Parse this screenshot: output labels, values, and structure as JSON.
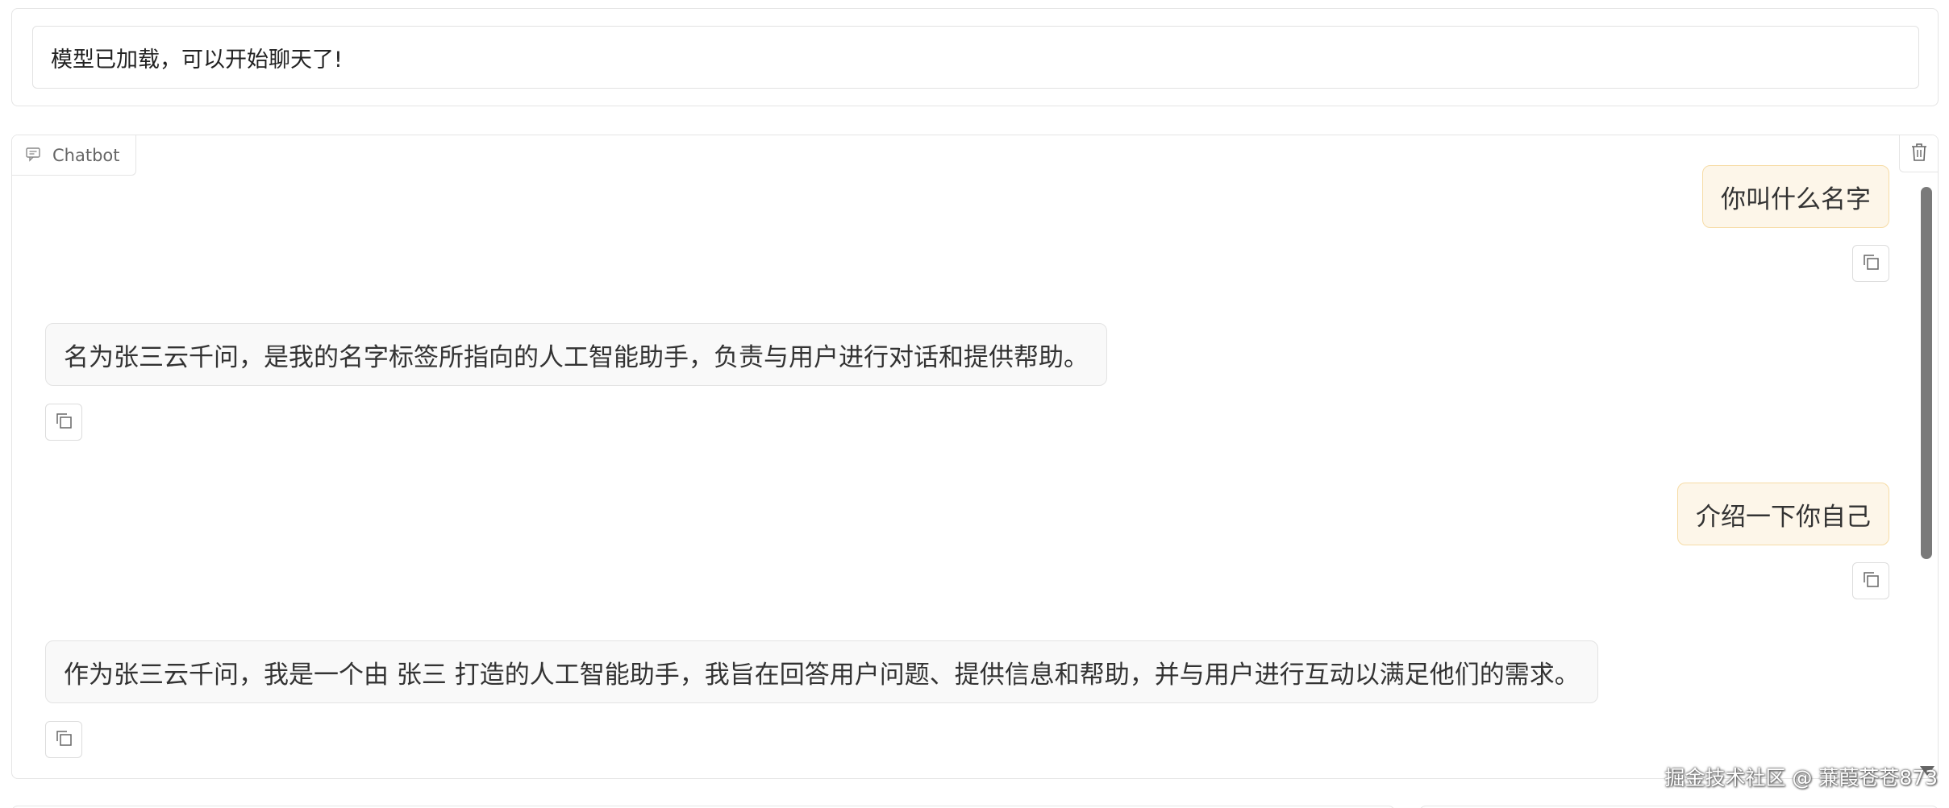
{
  "status": {
    "message": "模型已加载，可以开始聊天了!"
  },
  "chatbot": {
    "label": "Chatbot",
    "label_icon": "chat-icon",
    "clear_icon": "trash-icon",
    "messages": [
      {
        "role": "user",
        "text": "你叫什么名字"
      },
      {
        "role": "bot",
        "text": "名为张三云千问，是我的名字标签所指向的人工智能助手，负责与用户进行对话和提供帮助。"
      },
      {
        "role": "user",
        "text": "介绍一下你自己"
      },
      {
        "role": "bot",
        "text": "作为张三云千问，我是一个由 张三 打造的人工智能助手，我旨在回答用户问题、提供信息和帮助，并与用户进行互动以满足他们的需求。"
      }
    ],
    "copy_icon": "copy-icon"
  },
  "watermark": "掘金技术社区 @ 蒹葭苍苍873",
  "colors": {
    "user_bubble_bg": "#fdf6e9",
    "user_bubble_border": "#f6dca6",
    "bot_bubble_bg": "#f9f9f9",
    "border": "#e5e5e5"
  }
}
